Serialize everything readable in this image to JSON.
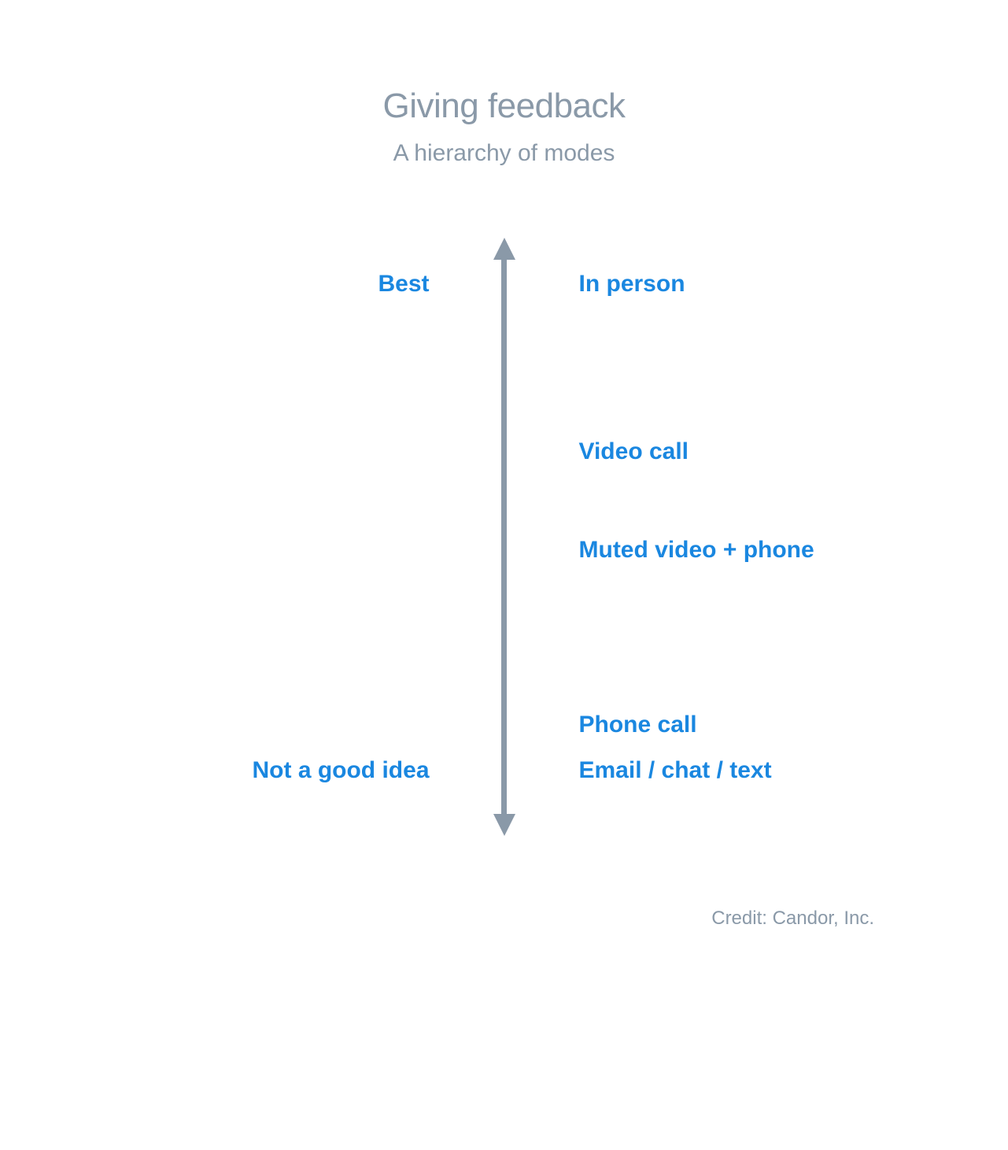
{
  "header": {
    "title": "Giving feedback",
    "subtitle": "A hierarchy of modes"
  },
  "axis": {
    "top_label": "Best",
    "bottom_label": "Not a good idea"
  },
  "modes": {
    "m1": "In person",
    "m2": "Video call",
    "m3": "Muted video + phone",
    "m4": "Phone call",
    "m5": "Email / chat / text"
  },
  "credit": "Credit: Candor, Inc."
}
